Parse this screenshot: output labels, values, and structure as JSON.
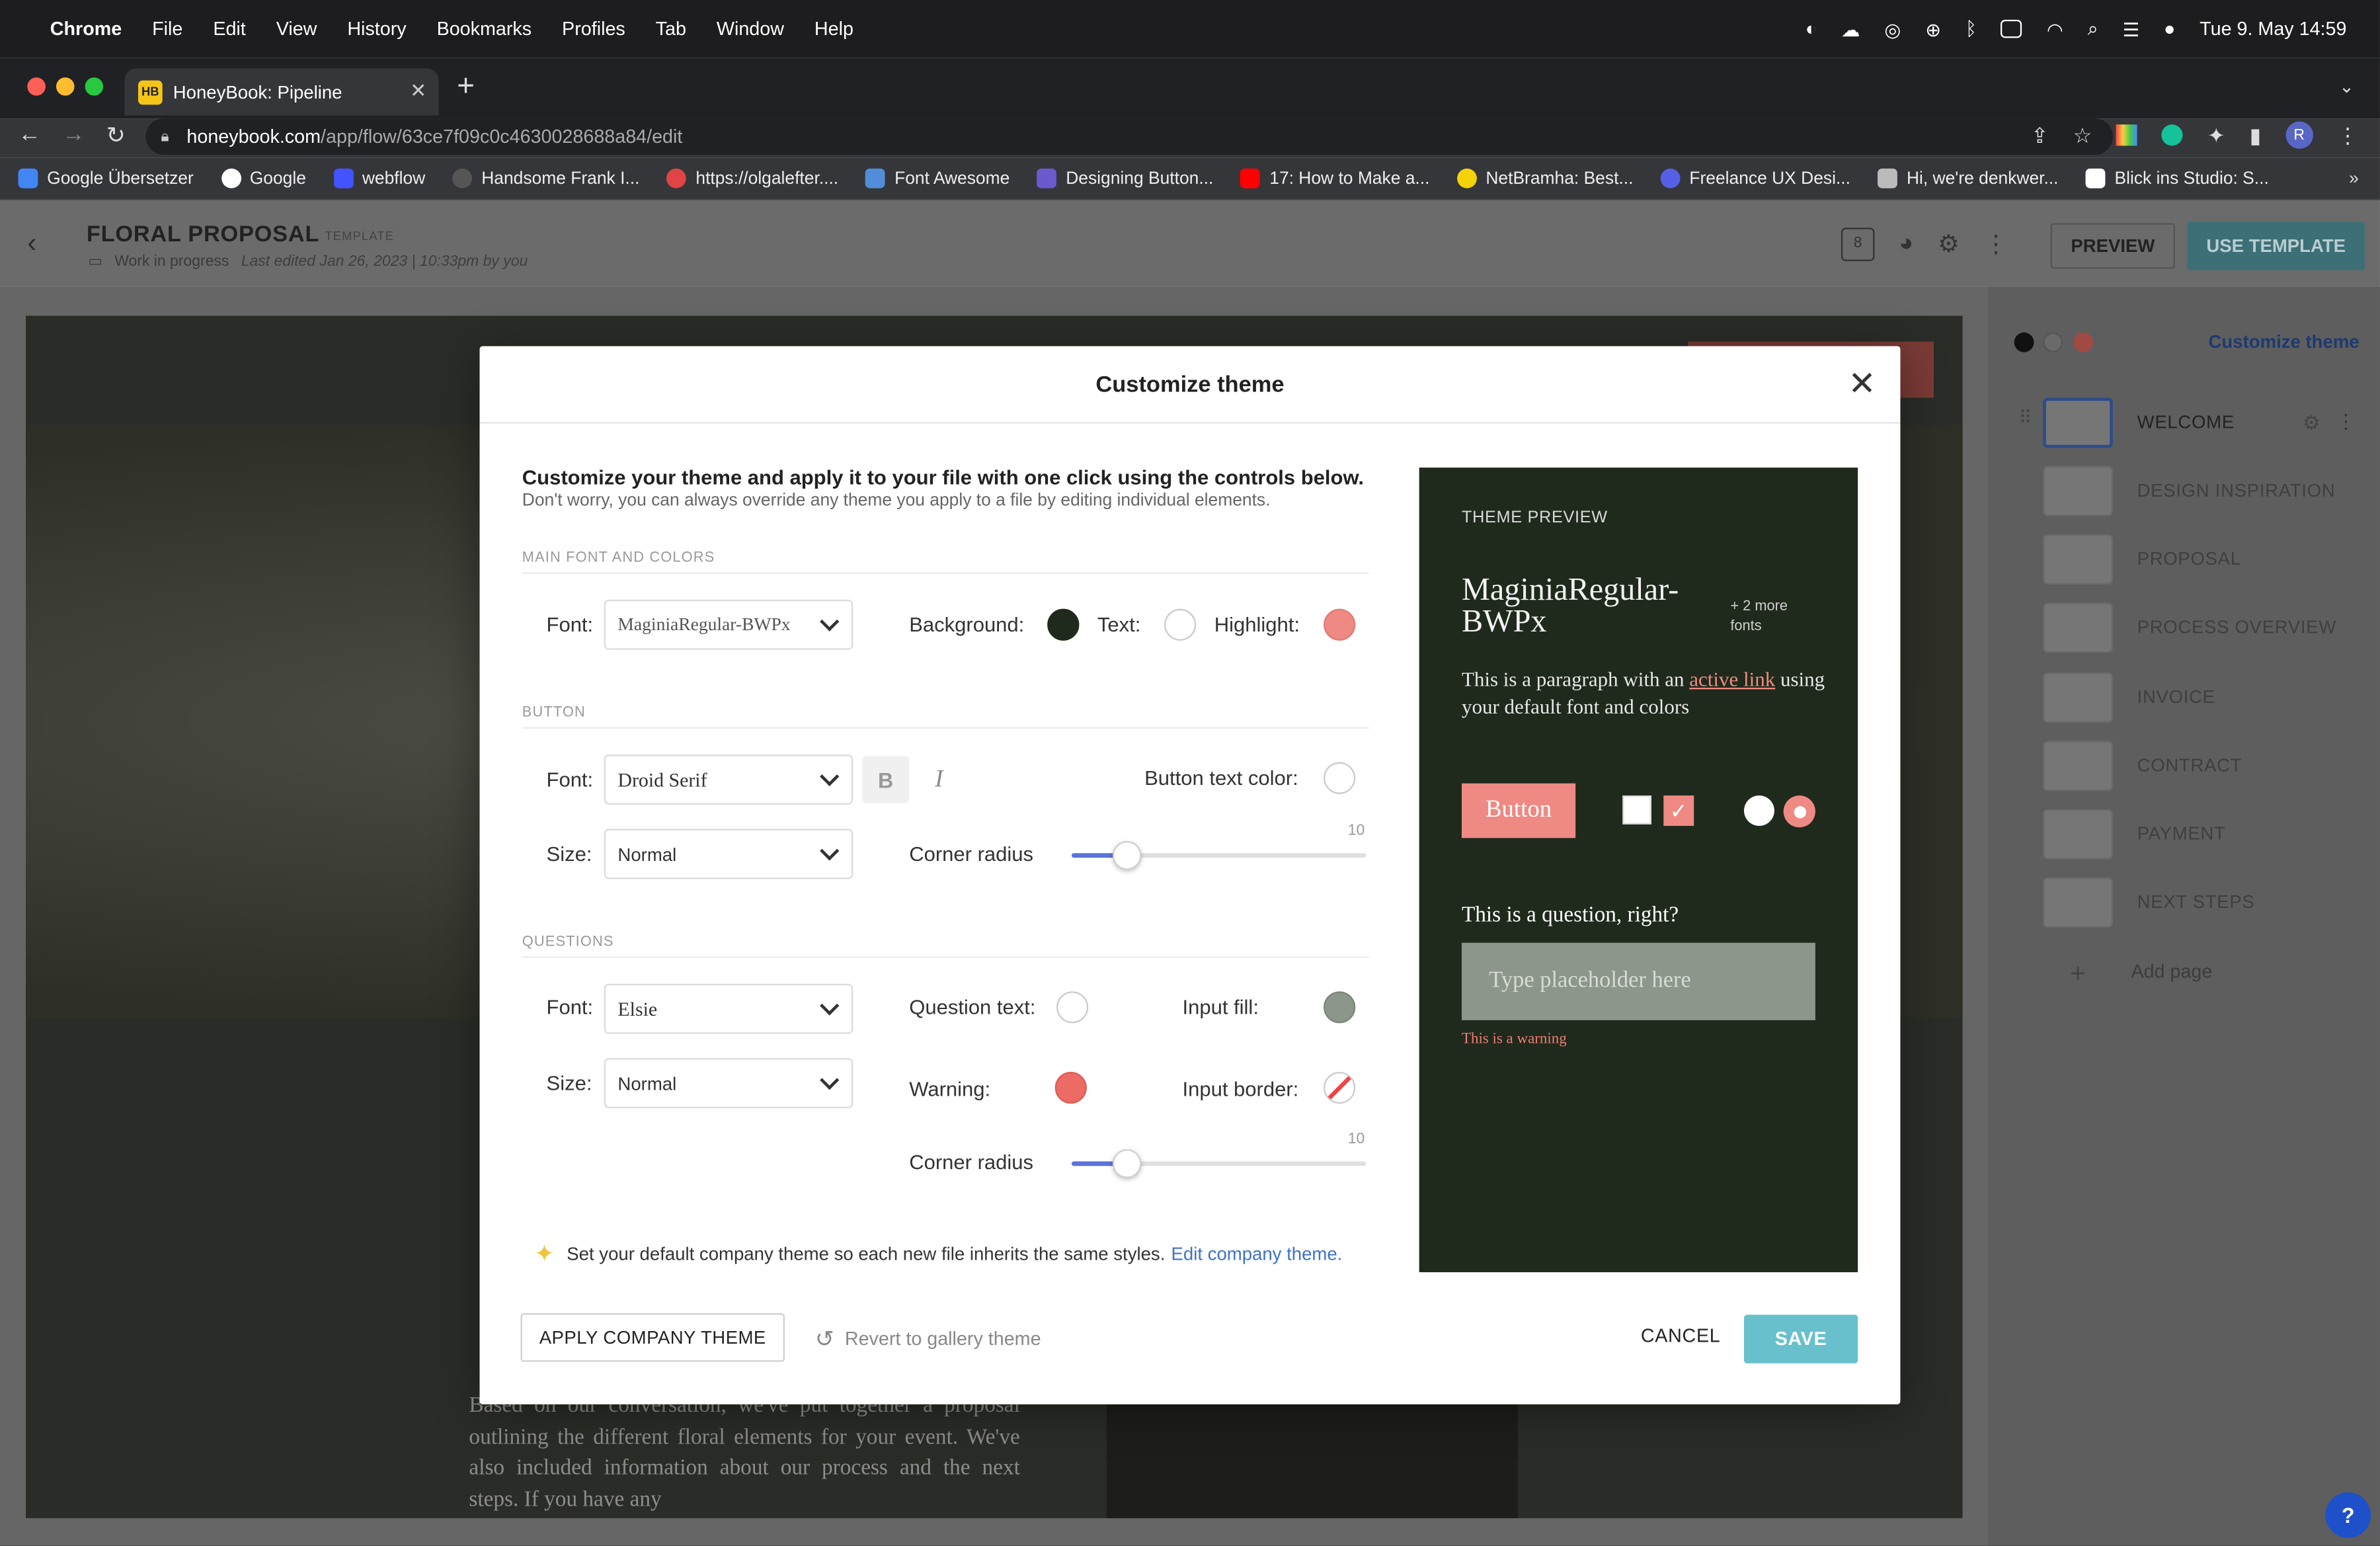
{
  "menubar": {
    "app": "Chrome",
    "items": [
      "File",
      "Edit",
      "View",
      "History",
      "Bookmarks",
      "Profiles",
      "Tab",
      "Window",
      "Help"
    ],
    "datetime": "Tue 9. May  14:59"
  },
  "browser": {
    "tab_title": "HoneyBook: Pipeline",
    "tab_favicon": "HB",
    "url_domain": "honeybook.com",
    "url_path": "/app/flow/63ce7f09c0c4630028688a84/edit",
    "profile_initial": "R",
    "bookmarks": [
      {
        "label": "Google Übersetzer",
        "color": "#4285f4"
      },
      {
        "label": "Google",
        "color": "#ffffff"
      },
      {
        "label": "webflow",
        "color": "#4353ff"
      },
      {
        "label": "Handsome Frank I...",
        "color": "#555555"
      },
      {
        "label": "https://olgalefter....",
        "color": "#e04444"
      },
      {
        "label": "Font Awesome",
        "color": "#528dd7"
      },
      {
        "label": "Designing Button...",
        "color": "#6a5acd"
      },
      {
        "label": "17: How to Make a...",
        "color": "#ff0000"
      },
      {
        "label": "NetBramha: Best...",
        "color": "#f5d20a"
      },
      {
        "label": "Freelance UX Desi...",
        "color": "#5560e6"
      },
      {
        "label": "Hi, we're denkwer...",
        "color": "#bbbbbb"
      },
      {
        "label": "Blick ins Studio: S...",
        "color": "#ffffff"
      }
    ]
  },
  "app_header": {
    "title": "FLORAL PROPOSAL",
    "badge": "TEMPLATE",
    "status": "Work in progress",
    "last_edited": "Last edited Jan 26, 2023 | 10:33pm by you",
    "pages_count": "8",
    "preview": "PREVIEW",
    "use_template": "USE TEMPLATE"
  },
  "side_panel": {
    "customize_link": "Customize theme",
    "pages": [
      "WELCOME",
      "DESIGN INSPIRATION",
      "PROPOSAL",
      "PROCESS OVERVIEW",
      "INVOICE",
      "CONTRACT",
      "PAYMENT",
      "NEXT STEPS"
    ],
    "add_page": "Add page",
    "help": "?"
  },
  "background_text": "Based on our conversation, we've put together a proposal outlining the different floral elements for your event. We've also included information about our process and the next steps. If you have any",
  "modal": {
    "title": "Customize theme",
    "intro_bold": "Customize your theme and apply it to your file with one click using the controls below.",
    "intro_sub": "Don't worry, you can always override any theme you apply to a file by editing individual elements.",
    "main_section": {
      "heading": "MAIN FONT AND COLORS",
      "font_label": "Font:",
      "font_value": "MaginiaRegular-BWPx",
      "background_label": "Background:",
      "text_label": "Text:",
      "highlight_label": "Highlight:"
    },
    "button_section": {
      "heading": "BUTTON",
      "font_label": "Font:",
      "font_value": "Droid Serif",
      "bold": "B",
      "italic": "I",
      "text_color_label": "Button text color:",
      "size_label": "Size:",
      "size_value": "Normal",
      "radius_label": "Corner radius",
      "radius_max": "10",
      "radius_value": 1
    },
    "questions_section": {
      "heading": "QUESTIONS",
      "font_label": "Font:",
      "font_value": "Elsie",
      "question_text_label": "Question text:",
      "input_fill_label": "Input fill:",
      "size_label": "Size:",
      "size_value": "Normal",
      "warning_label": "Warning:",
      "input_border_label": "Input border:",
      "radius_label": "Corner radius",
      "radius_max": "10",
      "radius_value": 1
    },
    "tip": "Set your default company theme so each new file inherits the same styles.",
    "tip_link": "Edit company theme.",
    "apply_company": "APPLY COMPANY THEME",
    "revert": "Revert to gallery theme",
    "cancel": "CANCEL",
    "save": "SAVE",
    "preview": {
      "label": "THEME PREVIEW",
      "font_name": "MaginiaRegular-BWPx",
      "more_fonts": "+ 2 more fonts",
      "para_start": "This is a paragraph with an",
      "para_link": "active link",
      "para_end": "using your default font and colors",
      "button": "Button",
      "question": "This is a question, right?",
      "placeholder": "Type placeholder here",
      "warning": "This is a warning"
    }
  },
  "colors": {
    "background": "#1f2a1c",
    "text": "#ffffff",
    "highlight": "#ee8a83",
    "button_text": "#ffffff",
    "question_text": "#ffffff",
    "input_fill": "#8c968a",
    "warning": "#ec6b65",
    "save_button": "#67c0cb"
  }
}
